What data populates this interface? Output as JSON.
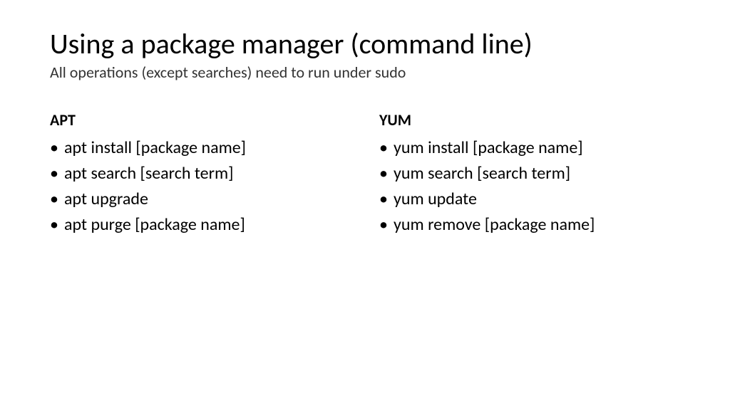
{
  "title": "Using a package manager (command line)",
  "subtitle": "All operations (except searches) need to run under sudo",
  "columns": [
    {
      "heading": "APT",
      "items": [
        "apt install [package name]",
        "apt search [search term]",
        "apt upgrade",
        "apt purge [package name]"
      ]
    },
    {
      "heading": "YUM",
      "items": [
        "yum install [package name]",
        "yum search [search term]",
        "yum update",
        "yum remove [package name]"
      ]
    }
  ]
}
